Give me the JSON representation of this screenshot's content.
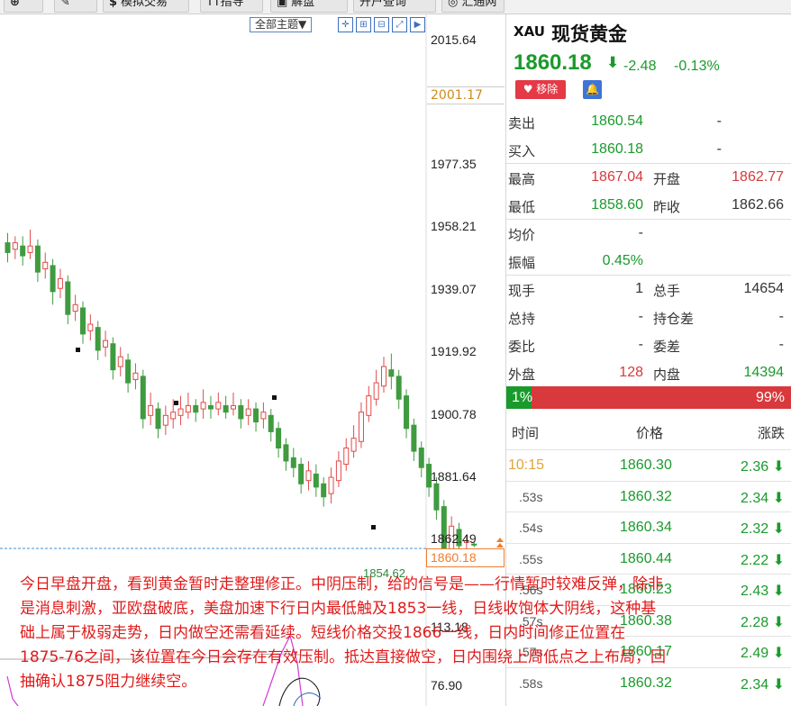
{
  "toolbar": {
    "buttons": [
      {
        "icon": "zoom-icon",
        "glyph": "⊕",
        "label": ""
      },
      {
        "icon": "pen-icon",
        "glyph": "✎",
        "label": ""
      },
      {
        "icon": "dollar-icon",
        "glyph": "$",
        "label": "模拟交易"
      },
      {
        "icon": "",
        "glyph": "",
        "label": "TT指导"
      },
      {
        "icon": "chat-icon",
        "glyph": "▣",
        "label": "解盘"
      },
      {
        "icon": "",
        "glyph": "",
        "label": "开户查询"
      },
      {
        "icon": "globe-icon",
        "glyph": "◎",
        "label": "汇通网"
      }
    ]
  },
  "chart": {
    "theme_select": "全部主题▼",
    "y_labels": [
      "2015.64",
      "1977.35",
      "1958.21",
      "1939.07",
      "1919.92",
      "1900.78",
      "1881.64",
      "1862.49"
    ],
    "y_highlight": "2001.17",
    "current_price": "1860.18",
    "low_label": "1854.62",
    "lower_labels": [
      "113.18",
      "76.90"
    ],
    "colors": {
      "up": "#e24a4a",
      "down": "#3f9b3f",
      "dashed": "#3c8fd6",
      "accent": "#ef7d2e"
    }
  },
  "quote": {
    "symbol": "XAU",
    "name": "现货黄金",
    "price": "1860.18",
    "change": "-2.48",
    "change_pct": "-0.13%",
    "remove_label": "移除",
    "rows": [
      {
        "label": "卖出",
        "value": "1860.54",
        "label2": "",
        "value2": "-",
        "color": "green"
      },
      {
        "label": "买入",
        "value": "1860.18",
        "label2": "",
        "value2": "-",
        "color": "green"
      },
      {
        "label": "最高",
        "value": "1867.04",
        "label2": "开盘",
        "value2": "1862.77",
        "color": "red",
        "color2": "red"
      },
      {
        "label": "最低",
        "value": "1858.60",
        "label2": "昨收",
        "value2": "1862.66",
        "color": "green",
        "color2": "dark"
      },
      {
        "label": "均价",
        "value": "-",
        "label2": "",
        "value2": "",
        "color": "dark"
      },
      {
        "label": "振幅",
        "value": "0.45%",
        "label2": "",
        "value2": "",
        "color": "green"
      },
      {
        "label": "现手",
        "value": "1",
        "label2": "总手",
        "value2": "14654",
        "color": "dark",
        "color2": "dark"
      },
      {
        "label": "总持",
        "value": "-",
        "label2": "持仓差",
        "value2": "-",
        "color": "dark",
        "color2": "dark"
      },
      {
        "label": "委比",
        "value": "-",
        "label2": "委差",
        "value2": "-",
        "color": "dark",
        "color2": "dark"
      },
      {
        "label": "外盘",
        "value": "128",
        "label2": "内盘",
        "value2": "14394",
        "color": "red",
        "color2": "green"
      }
    ],
    "ratio_buy": "1%",
    "ratio_sell": "99%",
    "ratio_buy_fraction": 0.01,
    "tick_headers": {
      "time": "时间",
      "price": "价格",
      "change": "涨跌"
    },
    "ticks": [
      {
        "time": "10:15",
        "price": "1860.30",
        "change": "2.36"
      },
      {
        "time": ".53s",
        "price": "1860.32",
        "change": "2.34"
      },
      {
        "time": ".54s",
        "price": "1860.34",
        "change": "2.32"
      },
      {
        "time": ".55s",
        "price": "1860.44",
        "change": "2.22"
      },
      {
        "time": ".56s",
        "price": "1860.23",
        "change": "2.43"
      },
      {
        "time": ".57s",
        "price": "1860.38",
        "change": "2.28"
      },
      {
        "time": ".57s",
        "price": "1860.17",
        "change": "2.49"
      },
      {
        "time": ".58s",
        "price": "1860.32",
        "change": "2.34"
      }
    ]
  },
  "overlay": {
    "lines": [
      "今日早盘开盘，看到黄金暂时走整理修正。中阴压制，给的信号是——行情暂时较难反弹，除非",
      "是消息刺激，亚欧盘破底，美盘加速下行日内最低触及1853一线，日线收饱体大阴线，这种基",
      "础上属于极弱走势，日内做空还需看延续。短线价格交投1866一线，日内时间修正位置在",
      "1875-76之间，该位置在今日会存在有效压制。抵达直接做空，日内围绕上周低点之上布局，回",
      "抽确认1875阻力继续空。"
    ]
  }
}
